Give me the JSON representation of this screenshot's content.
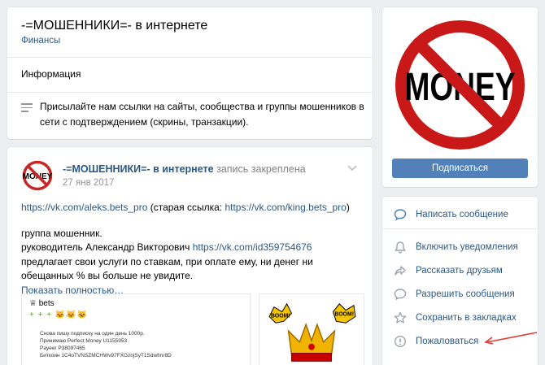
{
  "header": {
    "title": "-=МОШЕННИКИ=- в интернете",
    "category": "Финансы",
    "info_label": "Информация",
    "description": "Присылайте нам ссылки на сайты, сообщества и группы мошенников в сети с подтверждением (скрины, транзакции)."
  },
  "post": {
    "author": "-=МОШЕННИКИ=- в интернете",
    "pinned_note": "запись закреплена",
    "date": "27 янв 2017",
    "link1": "https://vk.com/aleks.bets_pro",
    "link1_suffix_open": " (старая ссылка: ",
    "link2": "https://vk.com/king.bets_pro",
    "link2_suffix": ")",
    "line_group": "группа мошенник.",
    "line_leader_prefix": "руководитель Александр Викторович ",
    "leader_link": "https://vk.com/id359754676",
    "line_offer": "предлагает свои услуги по ставкам, при оплате ему, ни денег ни обещанных % вы больше не увидите.",
    "show_more": "Показать полностью…",
    "image_left": {
      "title": "bets",
      "stars": "+ + + 🐱🐱🐱",
      "lines": [
        "Снова пишу подписку на один день 1000р.",
        "Принимаю Perfect Money U1155953",
        "Payeer P38097465",
        "Биткоин 1C4oTVNSZMCHWv97FXGznjSyT1Sdwfmr8D"
      ]
    },
    "image_right": {
      "boom1": "BOOM!",
      "boom2": "BOOM!"
    }
  },
  "sidebar": {
    "avatar_text": "MONEY",
    "subscribe_label": "Подписаться",
    "actions": [
      {
        "label": "Написать сообщение",
        "icon": "message-icon"
      },
      {
        "label": "Включить уведомления",
        "icon": "bell-icon"
      },
      {
        "label": "Рассказать друзьям",
        "icon": "share-icon"
      },
      {
        "label": "Разрешить сообщения",
        "icon": "chat-icon"
      },
      {
        "label": "Сохранить в закладках",
        "icon": "star-icon"
      },
      {
        "label": "Пожаловаться",
        "icon": "report-icon"
      }
    ]
  },
  "colors": {
    "link": "#2a5885",
    "button": "#5181b8",
    "background": "#edeef0",
    "arrow": "#e53935"
  }
}
